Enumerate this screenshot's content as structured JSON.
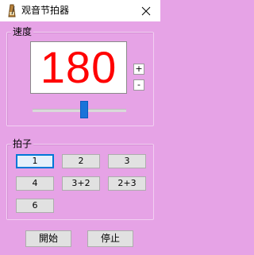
{
  "window": {
    "title": "观音节拍器",
    "icon": "metronome-icon",
    "close_icon": "close-icon"
  },
  "tempo": {
    "group_label": "速度",
    "value": "180",
    "increase_label": "+",
    "decrease_label": "-",
    "slider_level": 0.55,
    "value_color": "#ff0000"
  },
  "beat": {
    "group_label": "拍子",
    "options": [
      "1",
      "2",
      "3",
      "4",
      "3+2",
      "2+3",
      "6"
    ],
    "selected": "1"
  },
  "controls": {
    "start_label": "開始",
    "stop_label": "停止"
  },
  "colors": {
    "background": "#e6a3e6",
    "slider_thumb": "#1a73d9",
    "selection": "#0078d7"
  }
}
